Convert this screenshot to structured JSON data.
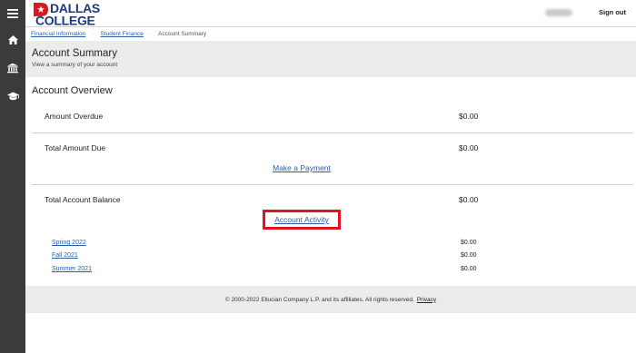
{
  "app": {
    "logo_line1": "DALLAS",
    "logo_line2": "COLLEGE",
    "signout_label": "Sign out"
  },
  "nav_rail": [
    {
      "icon": "hamburger-menu-icon"
    },
    {
      "icon": "home-icon"
    },
    {
      "icon": "bank-icon"
    },
    {
      "icon": "graduation-cap-icon"
    }
  ],
  "breadcrumb": {
    "items": [
      "Financial Information",
      "Student Finance",
      "Account Summary"
    ],
    "separator": "·"
  },
  "page": {
    "title": "Account Summary",
    "subtitle": "View a summary of your account"
  },
  "overview": {
    "title": "Account Overview",
    "amount_overdue": {
      "label": "Amount Overdue",
      "value": "$0.00"
    },
    "total_amount_due": {
      "label": "Total Amount Due",
      "value": "$0.00"
    },
    "make_payment_label": "Make a Payment",
    "total_account_balance": {
      "label": "Total Account Balance",
      "value": "$0.00"
    },
    "account_activity_label": "Account Activity",
    "terms": [
      {
        "name": "Spring 2022",
        "value": "$0.00"
      },
      {
        "name": "Fall 2021",
        "value": "$0.00"
      },
      {
        "name": "Summer 2021",
        "value": "$0.00"
      }
    ]
  },
  "footer": {
    "text": "© 2000-2022 Ellucian Company L.P. and its affiliates. All rights reserved.",
    "privacy_label": "Privacy"
  },
  "colors": {
    "rail": "#3b3b3b",
    "link": "#2a5ea8",
    "brand_red": "#d71a21",
    "brand_navy": "#1b3a78",
    "highlight": "#e0141e"
  }
}
